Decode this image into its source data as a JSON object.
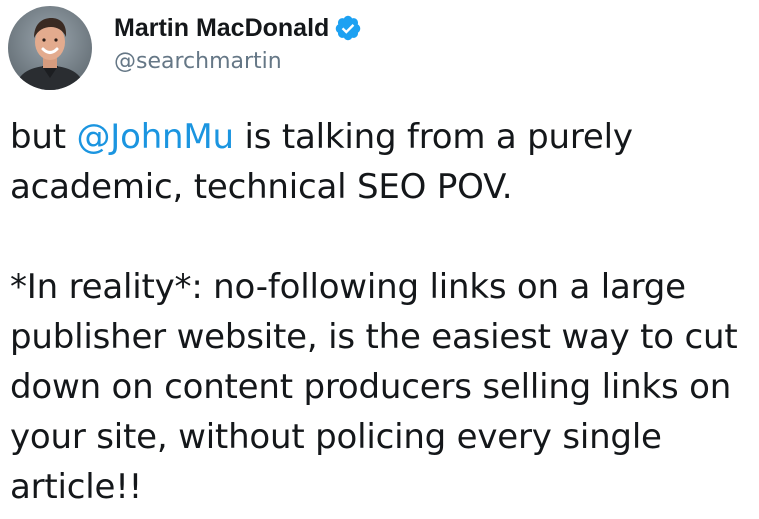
{
  "author": {
    "display_name": "Martin MacDonald",
    "handle": "@searchmartin",
    "verified_icon": "verified-badge-icon",
    "avatar_icon": "profile-photo"
  },
  "tweet": {
    "p1_before": "but ",
    "p1_mention": "@JohnMu",
    "p1_after": " is talking from a purely academic, technical SEO POV.",
    "p2": "*In reality*: no-following links on a large publisher website, is the easiest way to cut down on content producers selling links on your site, without policing every single article!!"
  },
  "colors": {
    "text": "#14171a",
    "secondary": "#657786",
    "link": "#1b95e0",
    "verified": "#1da1f2"
  }
}
